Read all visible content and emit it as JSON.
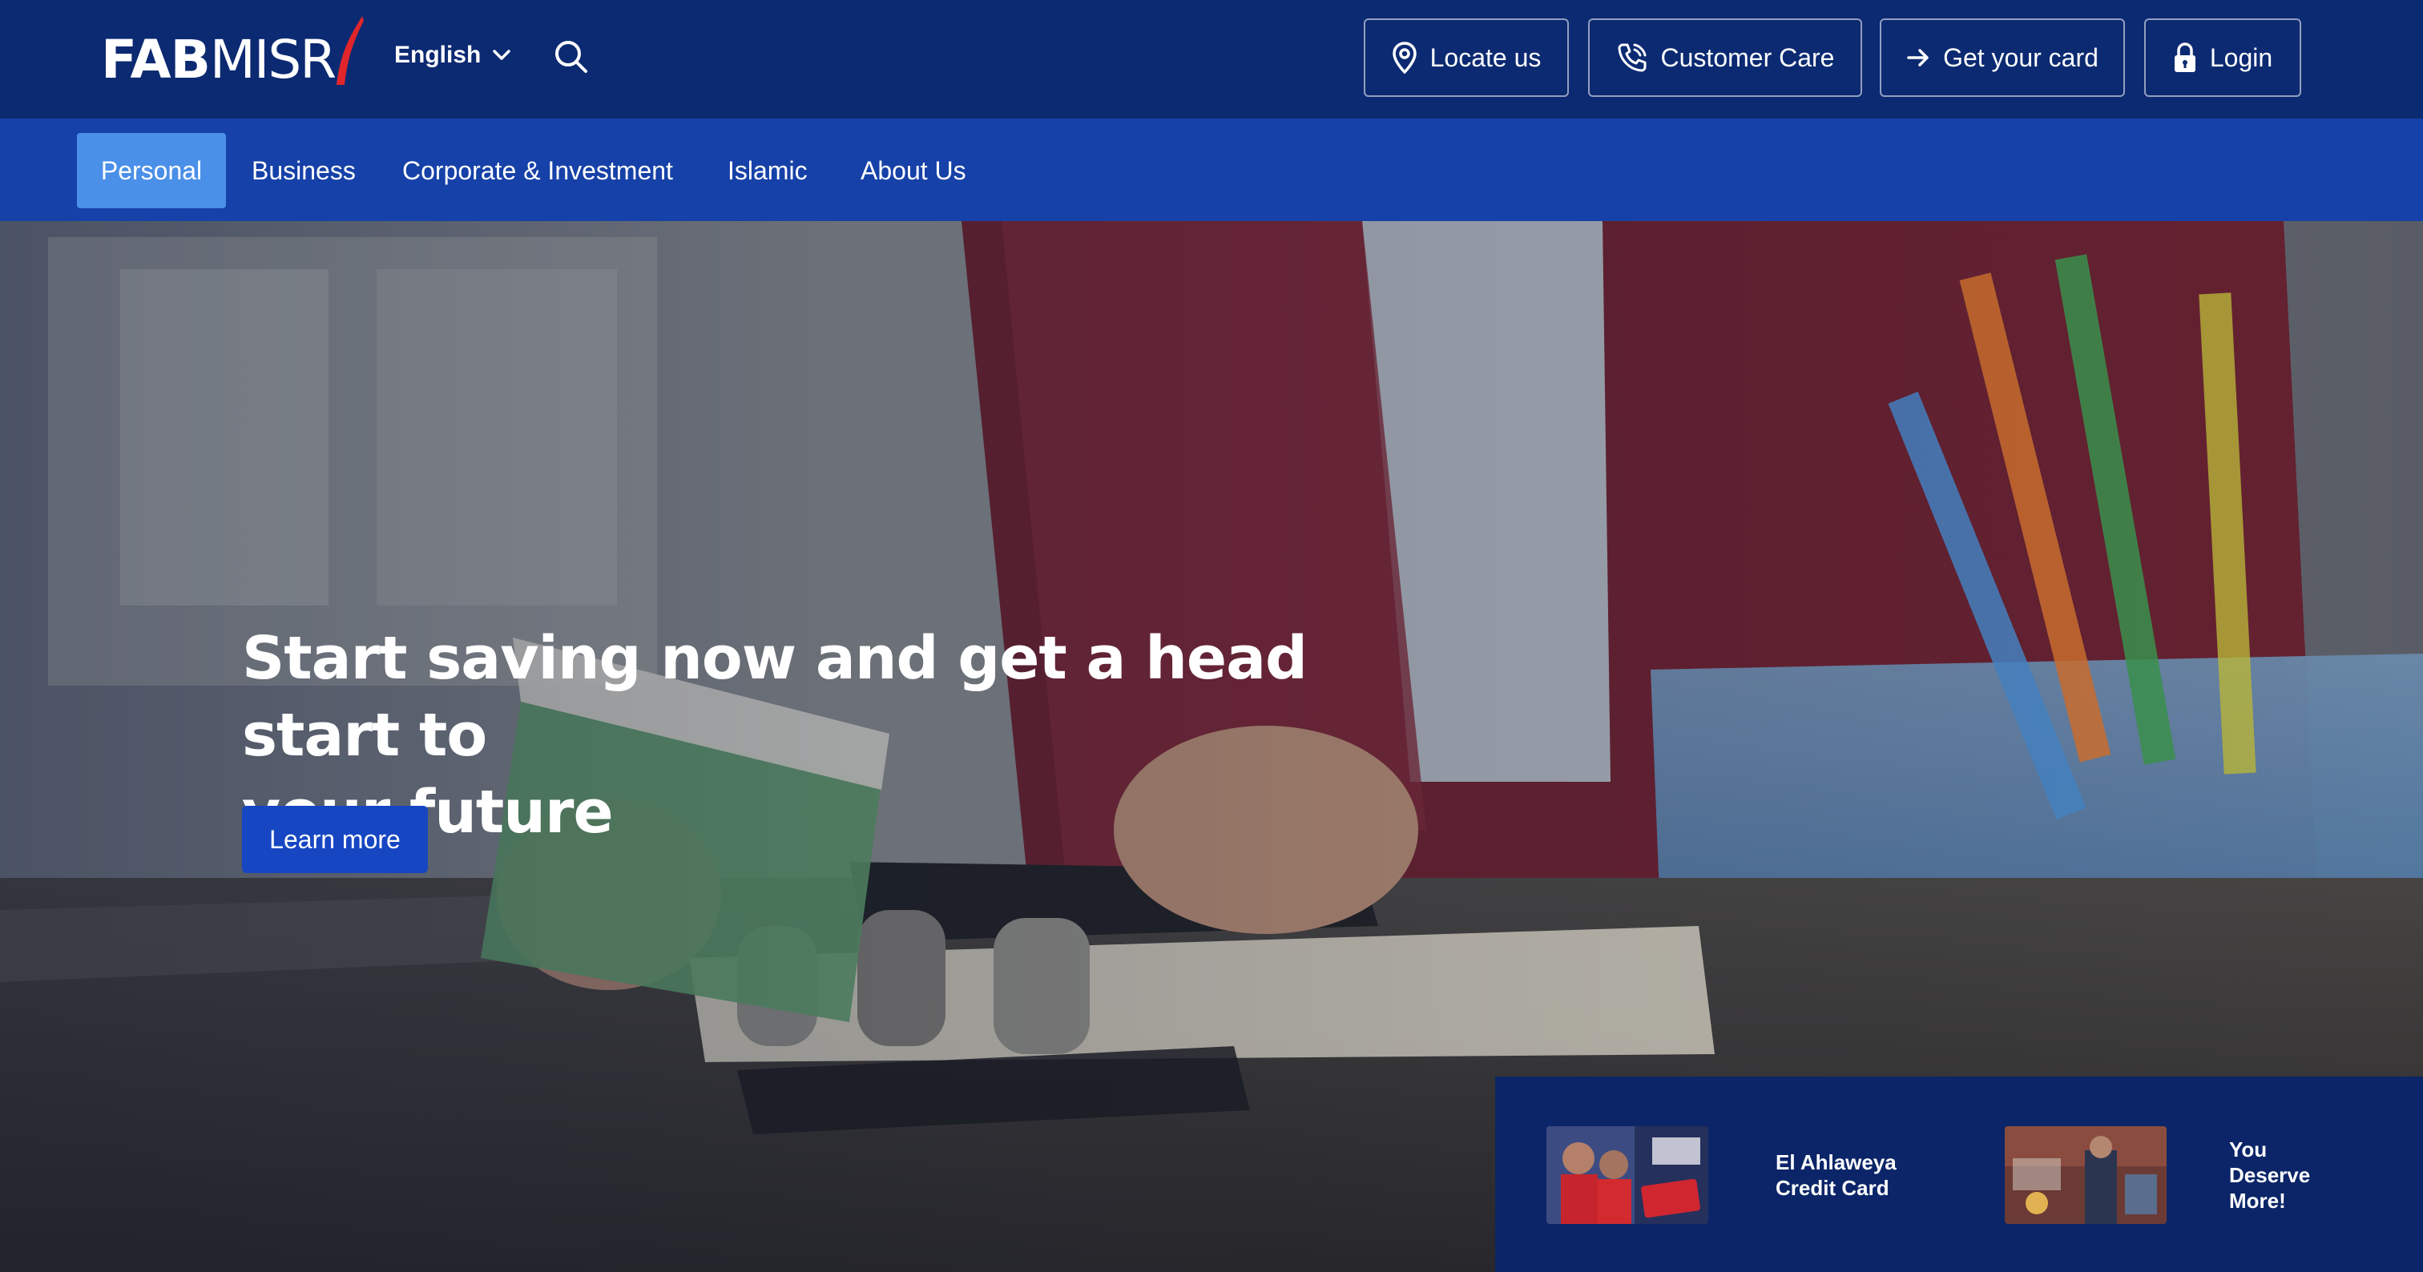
{
  "brand": {
    "part1": "FAB",
    "part2": "MISR",
    "accent_color": "#e0262b"
  },
  "header": {
    "language": "English",
    "buttons": {
      "locate": "Locate us",
      "care": "Customer Care",
      "card": "Get your card",
      "login": "Login"
    },
    "icons": [
      "chevron-down-icon",
      "search-icon",
      "location-pin-icon",
      "phone-icon",
      "arrow-right-icon",
      "lock-icon"
    ]
  },
  "nav": {
    "items": [
      "Personal",
      "Business",
      "Corporate & Investment",
      "Islamic",
      "About Us"
    ],
    "active": "Personal"
  },
  "hero": {
    "title_line1": "Start saving now and get a head start to",
    "title_line2": "your future",
    "cta": "Learn more"
  },
  "promos": [
    {
      "line1": "El Ahlaweya",
      "line2": "Credit Card"
    },
    {
      "line1": "You",
      "line2": "Deserve",
      "line3": "More!"
    }
  ],
  "colors": {
    "topbar": "#0c2a72",
    "navbar": "#1641a8",
    "active_tab": "#4a8fe8",
    "cta": "#1646c2"
  }
}
